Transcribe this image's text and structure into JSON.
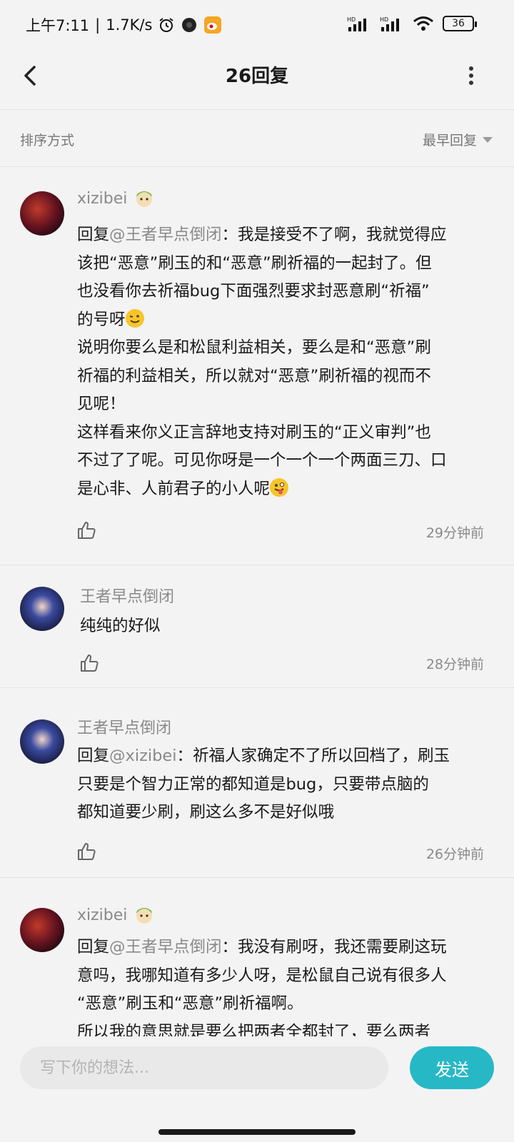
{
  "status_bar": {
    "time": "上午7:11",
    "separator": "|",
    "speed": "1.7K/s",
    "battery": "36",
    "icons": [
      "alarm-icon",
      "circle-app-icon",
      "weibo-icon",
      "signal-hd-icon",
      "signal-hd-icon",
      "wifi-icon",
      "battery-icon"
    ]
  },
  "header": {
    "title": "26回复",
    "back_icon": "back-arrow-icon",
    "more_icon": "more-vertical-icon"
  },
  "sort": {
    "label": "排序方式",
    "value": "最早回复"
  },
  "comments": [
    {
      "user": "xizibei",
      "avatar": "red-avatar",
      "badge": "character-badge-icon",
      "lines": [
        "回复@王者早点倒闭：我是接受不了啊，我就觉得应",
        "该把“恶意”刷玉的和“恶意”刷祈福的一起封了。但",
        "也没看你去祈福bug下面强烈要求封恶意刷“祈福”",
        "的号呀",
        "说明你要么是和松鼠利益相关，要么是和“恶意”刷",
        "祈福的利益相关，所以就对“恶意”刷祈福的视而不",
        "见呢！",
        "这样看来你义正言辞地支持对刷玉的“正义审判”也",
        "不过了了呢。可见你呀是一个一个一个两面三刀、口",
        "是心非、人前君子的小人呢"
      ],
      "mention": "@王者早点倒闭",
      "time": "29分钟前"
    },
    {
      "user": "王者早点倒闭",
      "avatar": "blue-avatar",
      "lines": [
        "纯纯的好似"
      ],
      "time": "28分钟前"
    },
    {
      "user": "王者早点倒闭",
      "avatar": "blue-avatar",
      "lines": [
        "回复@xizibei：祈福人家确定不了所以回档了，刷玉",
        "只要是个智力正常的都知道是bug，只要带点脑的",
        "都知道要少刷，刷这么多不是好似哦"
      ],
      "mention": "@xizibei",
      "time": "26分钟前"
    },
    {
      "user": "xizibei",
      "avatar": "red-avatar",
      "badge": "character-badge-icon",
      "lines": [
        "回复@王者早点倒闭：我没有刷呀，我还需要刷这玩",
        "意吗，我哪知道有多少人呀，是松鼠自己说有很多人",
        "“恶意”刷玉和“恶意”刷祈福啊。",
        "所以我的意思就是要么把两者全都封了，要么两者"
      ],
      "mention": "@王者早点倒闭"
    }
  ],
  "composer": {
    "placeholder": "写下你的想法...",
    "send_label": "发送"
  }
}
